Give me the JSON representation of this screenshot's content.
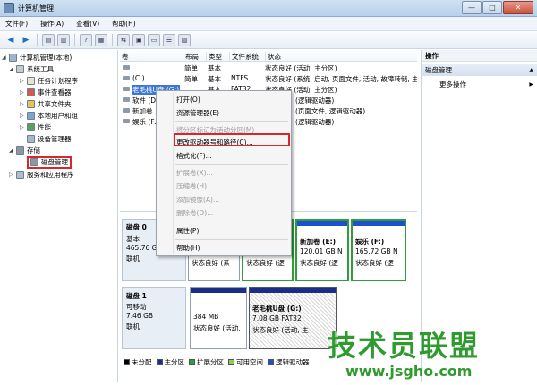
{
  "window": {
    "title": "计算机管理"
  },
  "menubar": [
    "文件(F)",
    "操作(A)",
    "查看(V)",
    "帮助(H)"
  ],
  "tree": {
    "root": "计算机管理(本地)",
    "system_tools": "系统工具",
    "task_scheduler": "任务计划程序",
    "event_viewer": "事件查看器",
    "shared_folders": "共享文件夹",
    "local_users": "本地用户和组",
    "performance": "性能",
    "device_manager": "设备管理器",
    "storage": "存储",
    "disk_management": "磁盘管理",
    "services_apps": "服务和应用程序"
  },
  "volumes": {
    "headers": [
      "卷",
      "布局",
      "类型",
      "文件系统",
      "状态"
    ],
    "rows": [
      {
        "name": "",
        "layout": "简单",
        "type": "基本",
        "fs": "",
        "status": "状态良好 (活动, 主分区)"
      },
      {
        "name": "(C:)",
        "layout": "简单",
        "type": "基本",
        "fs": "NTFS",
        "status": "状态良好 (系统, 启动, 页面文件, 活动, 故障转储, 主分区)"
      },
      {
        "name": "老毛桃U盘 (G:)",
        "layout": "简单",
        "type": "基本",
        "fs": "FAT32",
        "status": "状态良好 (活动, 主分区)"
      },
      {
        "name": "软件 (D:)",
        "layout": "",
        "type": "",
        "fs": "",
        "status": "(逻辑驱动器)"
      },
      {
        "name": "新加卷",
        "layout": "",
        "type": "",
        "fs": "",
        "status": "(页面文件, 逻辑驱动器)"
      },
      {
        "name": "娱乐 (F:)",
        "layout": "",
        "type": "",
        "fs": "",
        "status": "(逻辑驱动器)"
      }
    ]
  },
  "context_menu": {
    "open": "打开(O)",
    "explorer": "资源管理器(E)",
    "mark_active": "将分区标记为活动分区(M)",
    "change_letter": "更改驱动器号和路径(C)...",
    "format": "格式化(F)...",
    "extend": "扩展卷(X)...",
    "shrink": "压缩卷(H)...",
    "add_mirror": "添加镜像(A)...",
    "delete": "删除卷(D)...",
    "properties": "属性(P)",
    "help": "帮助(H)"
  },
  "disk0": {
    "name": "磁盘 0",
    "type": "基本",
    "size": "465.76 G",
    "status": "联机",
    "parts": [
      {
        "name": "",
        "size": "",
        "status": "状态良好 (系"
      },
      {
        "name": "",
        "size": "",
        "status": "状态良好 (逻"
      },
      {
        "name": "新加卷 (E:)",
        "size": "120.01 GB N",
        "status": "状态良好 (逻"
      },
      {
        "name": "娱乐 (F:)",
        "size": "165.72 GB N",
        "status": "状态良好 (逻"
      }
    ]
  },
  "disk1": {
    "name": "磁盘 1",
    "type": "可移动",
    "size": "7.46 GB",
    "status": "联机",
    "parts": [
      {
        "name": "",
        "size": "384 MB",
        "status": "状态良好 (活动,"
      },
      {
        "name": "老毛桃U盘 (G:)",
        "size": "7.08 GB FAT32",
        "status": "状态良好 (活动, 主"
      }
    ]
  },
  "legend": [
    {
      "label": "未分配",
      "color": "#000000"
    },
    {
      "label": "主分区",
      "color": "#1c2d86"
    },
    {
      "label": "扩展分区",
      "color": "#2f9e3a"
    },
    {
      "label": "可用空间",
      "color": "#8fd14f"
    },
    {
      "label": "逻辑驱动器",
      "color": "#1f4fd0"
    }
  ],
  "actions": {
    "header": "操作",
    "section": "磁盘管理",
    "more": "更多操作"
  },
  "watermark": {
    "big": "技术员联盟",
    "url": "www.jsgho.com"
  }
}
